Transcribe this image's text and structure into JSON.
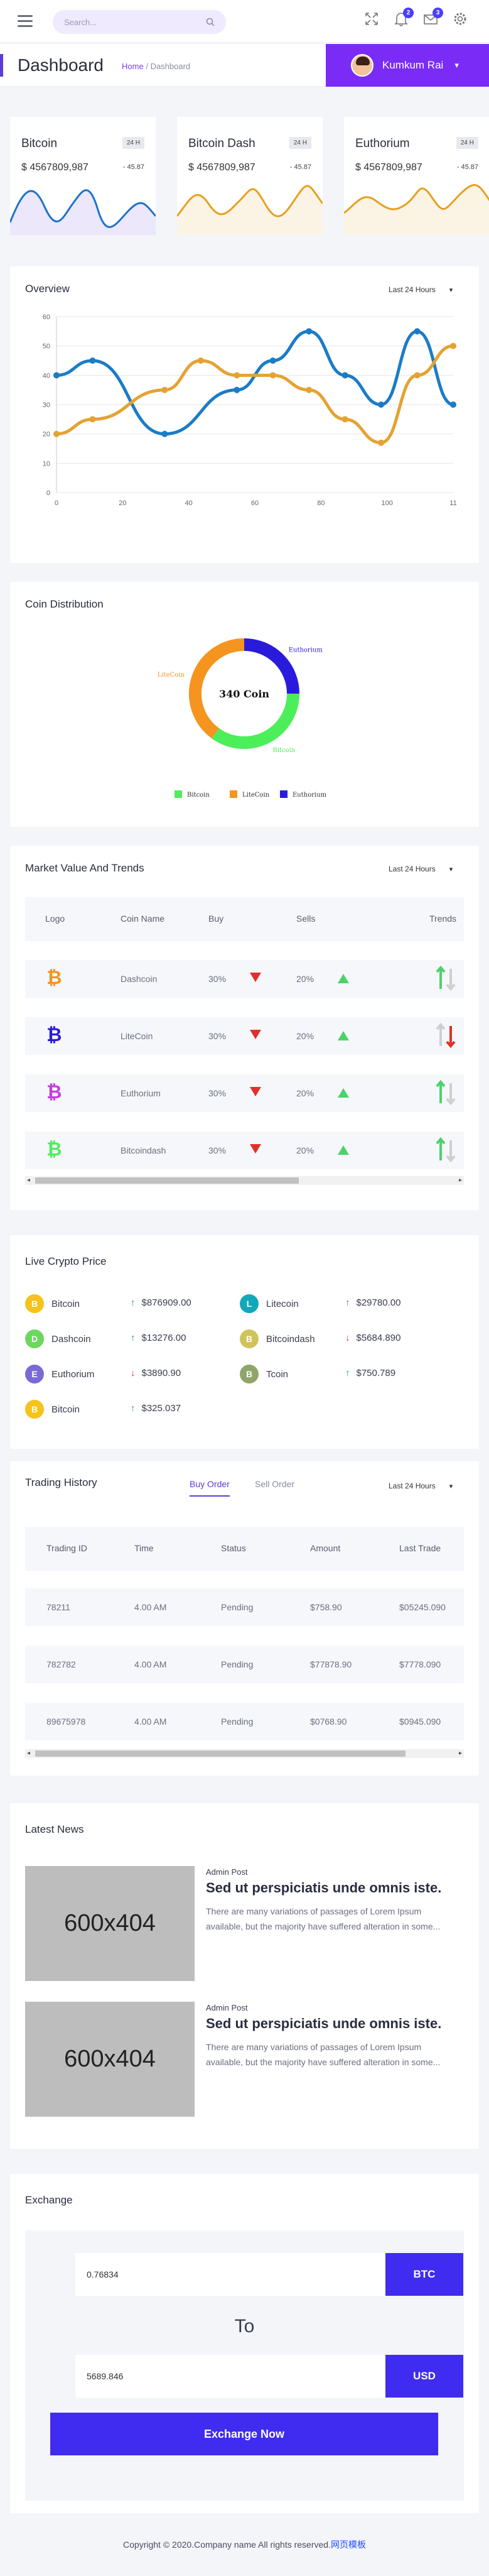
{
  "search": {
    "placeholder": "Search..."
  },
  "topbar": {
    "notif_count": "2",
    "mail_count": "3"
  },
  "header": {
    "title": "Dashboard",
    "crumb_home": "Home",
    "crumb_sep": "/",
    "crumb_current": "Dashboard",
    "user_name": "Kumkum Rai"
  },
  "coins": [
    {
      "name": "Bitcoin",
      "badge": "24 H",
      "price": "$ 4567809,987",
      "change": "- 45.87",
      "color": "#1d73c9",
      "fill": "#ece7fb"
    },
    {
      "name": "Bitcoin Dash",
      "badge": "24 H",
      "price": "$ 4567809,987",
      "change": "- 45.87",
      "color": "#e7a020",
      "fill": "#fbf4e4"
    },
    {
      "name": "Euthorium",
      "badge": "24 H",
      "price": "$ 4567809,987",
      "change": "- 45.87",
      "color": "#e7a020",
      "fill": "#fbf4e4"
    }
  ],
  "overview": {
    "title": "Overview",
    "range": "Last 24 Hours"
  },
  "chart_data": [
    {
      "type": "line",
      "title": "",
      "ylim": [
        0,
        60
      ],
      "xlim": [
        0,
        110
      ],
      "yticks": [
        "0",
        "10",
        "20",
        "30",
        "40",
        "50",
        "60"
      ],
      "xticks": [
        "0",
        "20",
        "40",
        "60",
        "80",
        "100",
        "11"
      ],
      "series": [
        {
          "color": "#1b7cc6",
          "x": [
            0,
            10,
            30,
            50,
            60,
            70,
            80,
            90,
            100,
            110
          ],
          "y": [
            40,
            45,
            20,
            35,
            45,
            55,
            40,
            30,
            55,
            30
          ]
        },
        {
          "color": "#e5a232",
          "x": [
            0,
            10,
            30,
            40,
            50,
            60,
            70,
            80,
            90,
            100,
            110
          ],
          "y": [
            20,
            25,
            35,
            45,
            40,
            40,
            35,
            25,
            17,
            40,
            50
          ]
        }
      ]
    },
    {
      "type": "pie",
      "title": "Coin Distribution",
      "center_label": "340 Coin",
      "labels": [
        "Bitcoin",
        "LiteCoin",
        "Euthorium"
      ],
      "values": [
        35,
        40,
        25
      ],
      "colors": [
        "#4cee5a",
        "#f5941f",
        "#2a1bdc"
      ]
    }
  ],
  "market": {
    "title": "Market Value And Trends",
    "range": "Last 24 Hours",
    "columns": [
      "Logo",
      "Coin Name",
      "Buy",
      "Sells",
      "Trends"
    ],
    "rows": [
      {
        "name": "Dashcoin",
        "buy": "30%",
        "sell": "20%",
        "color": "#f5941f"
      },
      {
        "name": "LiteCoin",
        "buy": "30%",
        "sell": "20%",
        "color": "#2a1bdc"
      },
      {
        "name": "Euthorium",
        "buy": "30%",
        "sell": "20%",
        "color": "#c73be0"
      },
      {
        "name": "Bitcoindash",
        "buy": "30%",
        "sell": "20%",
        "color": "#4cee5a"
      }
    ]
  },
  "live": {
    "title": "Live Crypto Price",
    "items": [
      {
        "letter": "B",
        "name": "Bitcoin",
        "price": "$876909.00",
        "dir": "up",
        "color": "#f6c21b"
      },
      {
        "letter": "L",
        "name": "Litecoin",
        "price": "$29780.00",
        "dir": "up",
        "color": "#12a8b9"
      },
      {
        "letter": "D",
        "name": "Dashcoin",
        "price": "$13276.00",
        "dir": "up",
        "color": "#6bd85d"
      },
      {
        "letter": "B",
        "name": "Bitcoindash",
        "price": "$5684.890",
        "dir": "down",
        "color": "#d0c35a"
      },
      {
        "letter": "E",
        "name": "Euthorium",
        "price": "$3890.90",
        "dir": "down",
        "color": "#7a6ad6"
      },
      {
        "letter": "B",
        "name": "Tcoin",
        "price": "$750.789",
        "dir": "up",
        "color": "#8fa56a"
      },
      {
        "letter": "B",
        "name": "Bitcoin",
        "price": "$325.037",
        "dir": "up",
        "color": "#f6c21b"
      }
    ]
  },
  "trading": {
    "title": "Trading History",
    "tab_buy": "Buy Order",
    "tab_sell": "Sell Order",
    "range": "Last 24 Hours",
    "columns": [
      "Trading ID",
      "Time",
      "Status",
      "Amount",
      "Last Trade"
    ],
    "rows": [
      {
        "id": "78211",
        "time": "4.00 AM",
        "status": "Pending",
        "amount": "$758.90",
        "last": "$05245.090"
      },
      {
        "id": "782782",
        "time": "4.00 AM",
        "status": "Pending",
        "amount": "$77878.90",
        "last": "$7778.090"
      },
      {
        "id": "89675978",
        "time": "4.00 AM",
        "status": "Pending",
        "amount": "$0768.90",
        "last": "$0945.090"
      }
    ]
  },
  "news": {
    "title": "Latest News",
    "items": [
      {
        "img": "600x404",
        "meta": "Admin Post",
        "headline": "Sed ut perspiciatis unde omnis iste.",
        "text": "There are many variations of passages of Lorem Ipsum available, but the majority have suffered alteration in some..."
      },
      {
        "img": "600x404",
        "meta": "Admin Post",
        "headline": "Sed ut perspiciatis unde omnis iste.",
        "text": "There are many variations of passages of Lorem Ipsum available, but the majority have suffered alteration in some..."
      }
    ]
  },
  "exchange": {
    "title": "Exchange",
    "from_value": "0.76834",
    "from_currency": "BTC",
    "to_label": "To",
    "to_value": "5689.846",
    "to_currency": "USD",
    "button": "Exchange Now"
  },
  "footer": {
    "text": "Copyright © 2020.Company name All rights reserved.",
    "link": "网页模板"
  }
}
